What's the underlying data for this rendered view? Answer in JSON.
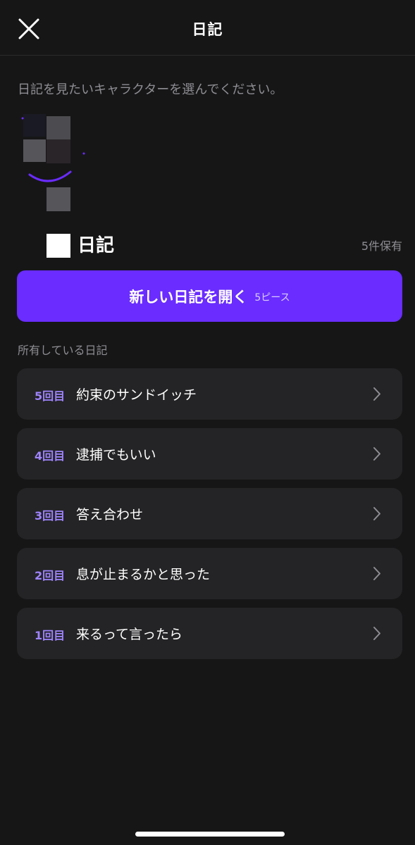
{
  "header": {
    "title": "日記"
  },
  "subtitle": "日記を見たいキャラクターを選んでください。",
  "character": {
    "name_suffix": "日記",
    "owned_count": "5件保有"
  },
  "open_button": {
    "label": "新しい日記を開く",
    "cost": "5ピース"
  },
  "section_label": "所有している日記",
  "entries": [
    {
      "number": "5回目",
      "title": "約束のサンドイッチ"
    },
    {
      "number": "4回目",
      "title": "逮捕でもいい"
    },
    {
      "number": "3回目",
      "title": "答え合わせ"
    },
    {
      "number": "2回目",
      "title": "息が止まるかと思った"
    },
    {
      "number": "1回目",
      "title": "来るって言ったら"
    }
  ],
  "colors": {
    "background": "#161617",
    "accent": "#6a2cff",
    "entry_number": "#9f84ff",
    "card": "#242426",
    "muted_text": "#8e8e93"
  },
  "icons": {
    "close": "close-icon",
    "chevron": "chevron-right-icon"
  }
}
